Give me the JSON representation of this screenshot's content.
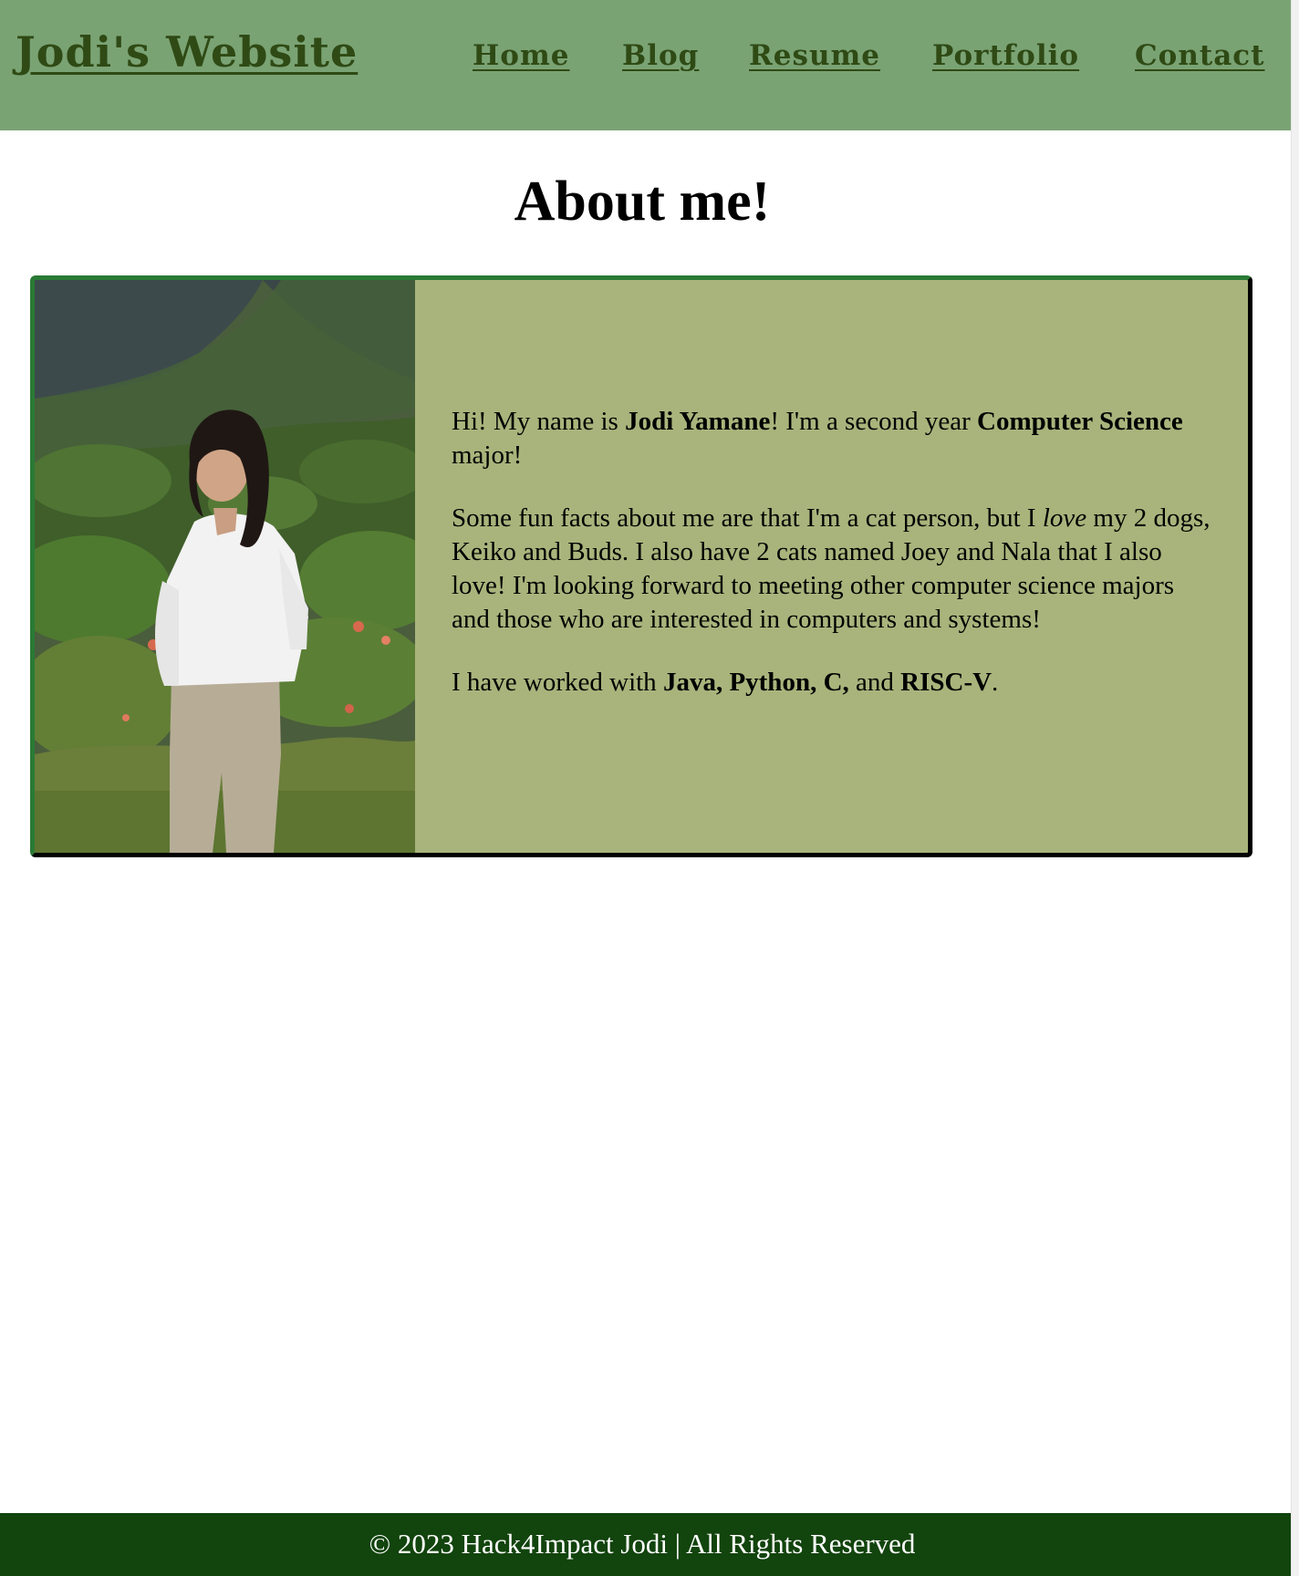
{
  "header": {
    "site_title": "Jodi's Website",
    "nav": {
      "home": "Home",
      "blog": "Blog",
      "resume": "Resume",
      "portfolio": "Portfolio",
      "contact": "Contact"
    }
  },
  "main": {
    "title": "About me!",
    "about": {
      "p1": {
        "t1": "Hi! My name is ",
        "b1": "Jodi Yamane",
        "t2": "! I'm a second year ",
        "b2": "Computer Science",
        "t3": " major!"
      },
      "p2": {
        "t1": "Some fun facts about me are that I'm a cat person, but I ",
        "em": "love",
        "t2": " my 2 dogs, Keiko and Buds. I also have 2 cats named Joey and Nala that I also love! I'm looking forward to meeting other computer science majors and those who are interested in computers and systems!"
      },
      "p3": {
        "t1": "I have worked with ",
        "b1": "Java, Python, C,",
        "t2": " and ",
        "b2": "RISC-V",
        "t3": "."
      }
    }
  },
  "footer": {
    "text": "© 2023 Hack4Impact Jodi | All Rights Reserved"
  },
  "colors": {
    "header_bg": "#7aa374",
    "header_text": "#2f4a14",
    "card_bg": "#a9b47c",
    "card_border": "#2a7a35",
    "footer_bg": "#12440d"
  }
}
